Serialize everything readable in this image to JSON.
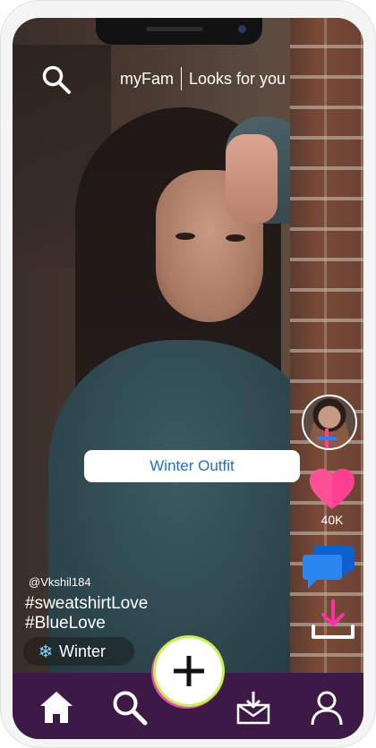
{
  "header": {
    "app_name": "myFam",
    "section_title": "Looks for you"
  },
  "post": {
    "outfit_tag": "Winter Outfit",
    "username": "@Vkshil184",
    "hashtags": [
      "#sweatshirtLove",
      "#BlueLove"
    ],
    "season_chip": "Winter",
    "likes": "40K"
  },
  "colors": {
    "tab_bar": "#3d1a45",
    "like_heart": "#ff3f8f",
    "comment_bubble": "#1a73e8",
    "download_arrow": "#ff2fa4",
    "outfit_text": "#1f6fc4"
  },
  "icons": {
    "top": "search-icon",
    "actions": [
      "creator-avatar",
      "heart-icon",
      "comment-icon",
      "download-icon"
    ],
    "tabs": [
      "home-icon",
      "search-icon",
      "add-icon",
      "inbox-icon",
      "profile-icon"
    ]
  }
}
